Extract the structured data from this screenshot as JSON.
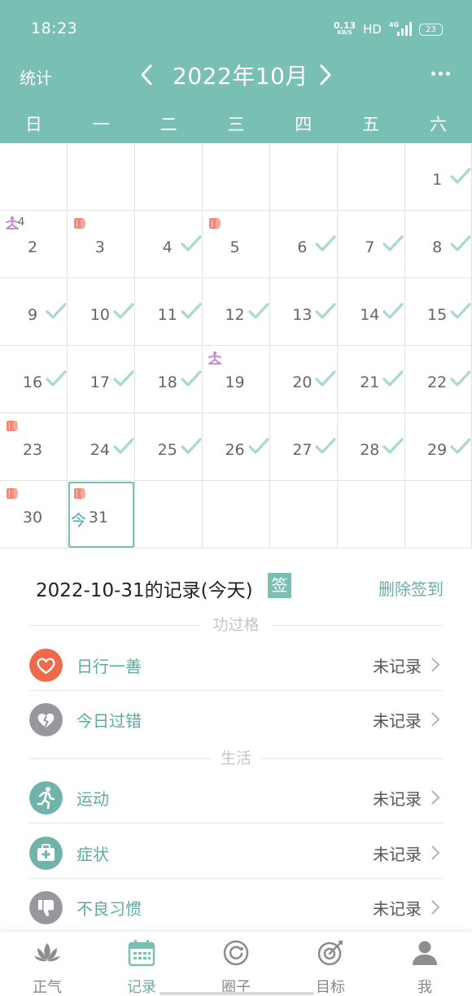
{
  "status_bar": {
    "time": "18:23",
    "net_speed": "0.13",
    "net_unit": "KB/S",
    "hd": "HD",
    "signal": "4G",
    "battery": "23"
  },
  "header": {
    "stats_label": "统计",
    "month": "2022年10月"
  },
  "weekdays": [
    "日",
    "一",
    "二",
    "三",
    "四",
    "五",
    "六"
  ],
  "calendar": {
    "today_label": "今",
    "days": [
      {
        "day": "1",
        "checked": true,
        "icon": ""
      },
      {
        "day": "2",
        "checked": false,
        "icon": "yoga",
        "icon_count": "4"
      },
      {
        "day": "3",
        "checked": false,
        "icon": "roll"
      },
      {
        "day": "4",
        "checked": true,
        "icon": ""
      },
      {
        "day": "5",
        "checked": false,
        "icon": "roll"
      },
      {
        "day": "6",
        "checked": true,
        "icon": ""
      },
      {
        "day": "7",
        "checked": true,
        "icon": ""
      },
      {
        "day": "8",
        "checked": true,
        "icon": ""
      },
      {
        "day": "9",
        "checked": true,
        "icon": ""
      },
      {
        "day": "10",
        "checked": true,
        "icon": ""
      },
      {
        "day": "11",
        "checked": true,
        "icon": ""
      },
      {
        "day": "12",
        "checked": true,
        "icon": ""
      },
      {
        "day": "13",
        "checked": true,
        "icon": ""
      },
      {
        "day": "14",
        "checked": true,
        "icon": ""
      },
      {
        "day": "15",
        "checked": true,
        "icon": ""
      },
      {
        "day": "16",
        "checked": true,
        "icon": ""
      },
      {
        "day": "17",
        "checked": true,
        "icon": ""
      },
      {
        "day": "18",
        "checked": true,
        "icon": ""
      },
      {
        "day": "19",
        "checked": false,
        "icon": "yoga"
      },
      {
        "day": "20",
        "checked": true,
        "icon": ""
      },
      {
        "day": "21",
        "checked": true,
        "icon": ""
      },
      {
        "day": "22",
        "checked": true,
        "icon": ""
      },
      {
        "day": "23",
        "checked": false,
        "icon": "roll"
      },
      {
        "day": "24",
        "checked": true,
        "icon": ""
      },
      {
        "day": "25",
        "checked": true,
        "icon": ""
      },
      {
        "day": "26",
        "checked": true,
        "icon": ""
      },
      {
        "day": "27",
        "checked": true,
        "icon": ""
      },
      {
        "day": "28",
        "checked": true,
        "icon": ""
      },
      {
        "day": "29",
        "checked": true,
        "icon": ""
      },
      {
        "day": "30",
        "checked": false,
        "icon": "roll"
      },
      {
        "day": "31",
        "checked": false,
        "icon": "roll",
        "today": true
      }
    ]
  },
  "record": {
    "title": "2022-10-31的记录(今天)",
    "sign_badge": "签",
    "delete_label": "删除签到",
    "section_merit": "功过格",
    "section_life": "生活",
    "items": [
      {
        "label": "日行一善",
        "status": "未记录",
        "icon": "heart-icon"
      },
      {
        "label": "今日过错",
        "status": "未记录",
        "icon": "broken-heart-icon"
      },
      {
        "label": "运动",
        "status": "未记录",
        "icon": "runner-icon"
      },
      {
        "label": "症状",
        "status": "未记录",
        "icon": "medical-kit-icon"
      },
      {
        "label": "不良习惯",
        "status": "未记录",
        "icon": "thumbs-down-icon"
      }
    ]
  },
  "colors": {
    "accent": "#79bfb3",
    "check": "#a9d8d2",
    "heart": "#ef6a4a",
    "grey_icon": "#9a969f",
    "roll": "#f08a78",
    "yoga": "#c98ad8"
  },
  "tabs": [
    {
      "label": "正气",
      "icon": "lotus-icon"
    },
    {
      "label": "记录",
      "icon": "calendar-icon",
      "active": true
    },
    {
      "label": "圈子",
      "icon": "circle-icon"
    },
    {
      "label": "目标",
      "icon": "target-icon"
    },
    {
      "label": "我",
      "icon": "person-icon"
    }
  ]
}
